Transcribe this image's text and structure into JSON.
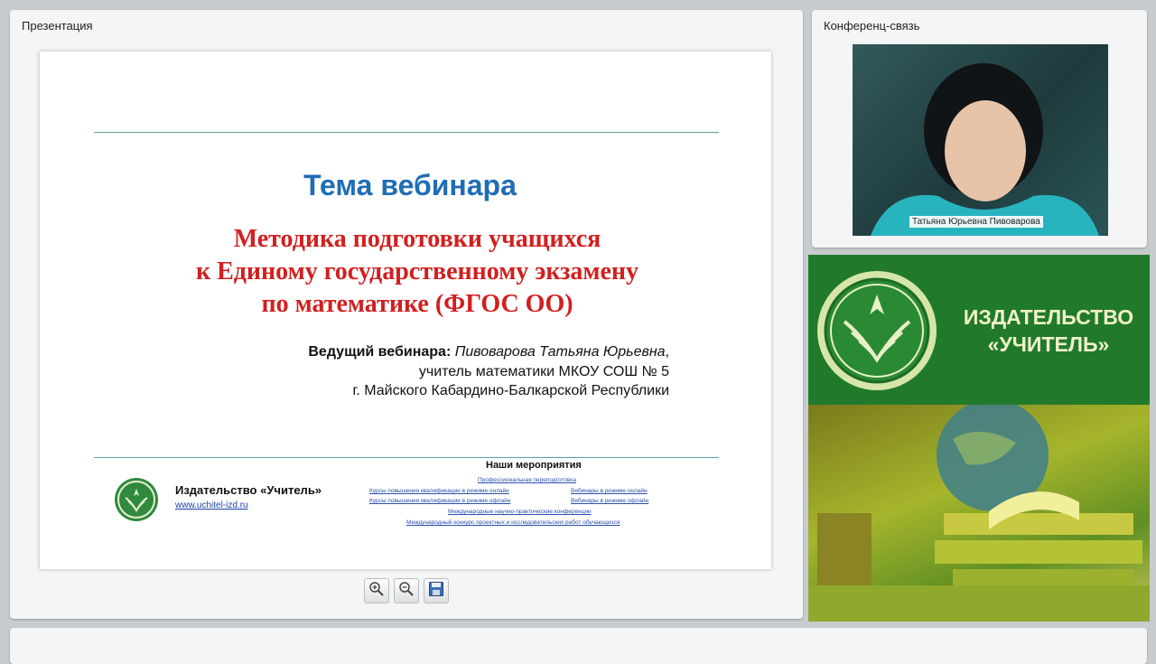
{
  "presentation": {
    "title": "Презентация"
  },
  "conference": {
    "title": "Конференц-связь",
    "speaker_name": "Татьяна Юрьевна Пивоварова"
  },
  "slide": {
    "heading": "Тема вебинара",
    "topic_lines": [
      "Методика подготовки учащихся",
      "к Единому государственному экзамену",
      "по математике (ФГОС ОО)"
    ],
    "presenter_label": "Ведущий вебинара:",
    "presenter_name": "Пивоварова Татьяна Юрьевна",
    "presenter_suffix": ",",
    "presenter_line2": "учитель математики МКОУ СОШ № 5",
    "presenter_line3": "г. Майского Кабардино-Балкарской Республики",
    "publisher_name": "Издательство «Учитель»",
    "publisher_url": "www.uchitel-izd.ru",
    "events_title": "Наши мероприятия",
    "events": [
      "Профессиональная переподготовка",
      "Курсы повышения квалификации в режиме онлайн",
      "Вебинары в режиме онлайн",
      "Курсы повышения квалификации в режиме офлайн",
      "Вебинары в режиме офлайн",
      "Международные научно-практические конференции",
      "Международный конкурс проектных и исследовательских работ обучающихся"
    ]
  },
  "toolbar": {
    "zoom_in_icon": "zoom-in-icon",
    "zoom_out_icon": "zoom-out-icon",
    "save_icon": "save-icon"
  },
  "ad": {
    "line1": "ИЗДАТЕЛЬСТВО",
    "line2": "«УЧИТЕЛЬ»",
    "brand_color": "#217a2c"
  }
}
